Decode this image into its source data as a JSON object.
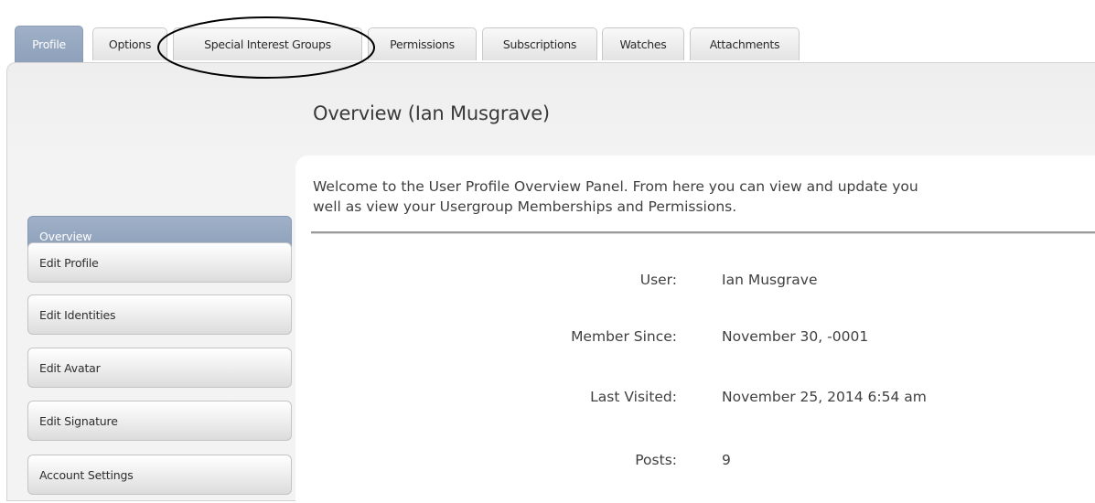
{
  "tabs": [
    {
      "label": "Profile",
      "active": true
    },
    {
      "label": "Options"
    },
    {
      "label": "Special Interest Groups"
    },
    {
      "label": "Permissions"
    },
    {
      "label": "Subscriptions"
    },
    {
      "label": "Watches"
    },
    {
      "label": "Attachments"
    }
  ],
  "main": {
    "title": "Overview (Ian Musgrave)",
    "intro_line1": "Welcome to the User Profile Overview Panel. From here you can view and update you",
    "intro_line2": "well as view your Usergroup Memberships and Permissions.",
    "info": [
      {
        "label": "User:",
        "value": "Ian Musgrave"
      },
      {
        "label": "Member Since:",
        "value": "November 30, -0001"
      },
      {
        "label": "Last Visited:",
        "value": "November 25, 2014 6:54 am"
      },
      {
        "label": "Posts:",
        "value": "9"
      }
    ]
  },
  "sidebar": {
    "items": [
      {
        "label": "Overview",
        "active": true
      },
      {
        "label": "Edit Profile"
      },
      {
        "label": "Edit Identities"
      },
      {
        "label": "Edit Avatar"
      },
      {
        "label": "Edit Signature"
      },
      {
        "label": "Account Settings"
      }
    ]
  },
  "colors": {
    "active_tab": "#97a8c1",
    "active_sidebar": "#97a8c1",
    "annotation_ellipse": "#000000"
  }
}
